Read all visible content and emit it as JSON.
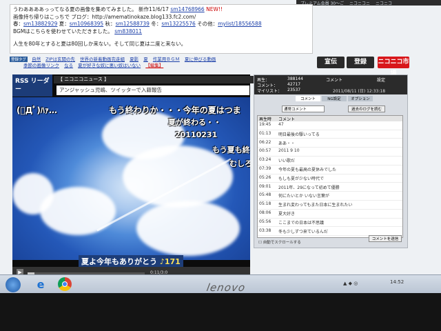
{
  "top_strip": [
    "プレミアム会員 30～ご",
    "ニコニコニ",
    "ニコニコ"
  ],
  "description": {
    "line1_text": "うわああああっってなる夏の画像を集めてみました。 新作11/6/17",
    "line1_link": "sm14768966",
    "line1_new": "NEW!!",
    "line2": "画像持ち帰りはこっちで ブログ：http://amematinokaze.blog133.fc2.com/",
    "line3_parts": [
      "春：",
      "sm13882929",
      " 夏：",
      "sm10968395",
      " 秋：",
      "sm12588739",
      " 冬：",
      "sm13225576",
      " その他：",
      "mylist/18556588"
    ],
    "line4_text": "BGMはこちらを使わせていただきました。",
    "line4_link": "sm838011",
    "line5": "人生を80年とすると夏は80回しか来ない。そして同じ夏は二度と来ない。"
  },
  "tags": {
    "lock_label": "登録タグ",
    "row1": [
      "自然",
      "ZIPは玄関の先",
      "世界の新着動画完走組",
      "夏影",
      "夏",
      "作業用ＢＧＭ",
      "夏に伸びる動画"
    ],
    "row2": [
      "季節の画像リンク",
      "なる",
      "夏が好きな奴に悪い奴はいない",
      "【編集】"
    ]
  },
  "buttons": {
    "ad": "宣伝",
    "mylist": "登録",
    "ichiba": "ニコニコ市場"
  },
  "player": {
    "rss": "RSS リーダー",
    "head": "【 ニコニコニュース 】",
    "news": "アンジャッシュ児嶋、ツイッターで入籍報告",
    "comments": [
      "(ﾟДﾟ)ﾊｧ…",
      "もう終わりか・・・今年の夏はつま",
      "夏が終わる・・",
      "20110231",
      "もう夏も終",
      "むしろ"
    ],
    "bottom_comment": "夏よ今年もありがとう",
    "bottom_num": "♪171",
    "play_icon": "play-icon",
    "time": "0:11/3:0",
    "progress": 0.06
  },
  "panel": {
    "stats": {
      "play_label": "再生：",
      "play_value": "388144",
      "comment_label": "コメント：",
      "comment_value": "42717",
      "mylist_label": "マイリスト：",
      "mylist_value": "23537"
    },
    "header_comment": "コメント",
    "header_settings": "設定",
    "date": "2011/08/11 (日) 12:33:18",
    "tabs": [
      "コメント",
      "NG設定",
      "オプション"
    ],
    "select": "通常コメント",
    "update_button": "過去のログを読む",
    "list_header": {
      "time": "再生時",
      "comment": "コメント"
    },
    "rows": [
      {
        "time": "19:45",
        "text": "47"
      },
      {
        "time": "01:13",
        "text": "明日最後の駆いってる"
      },
      {
        "time": "06:22",
        "text": "ああ・・"
      },
      {
        "time": "00:57",
        "text": "2011 9 10"
      },
      {
        "time": "03:24",
        "text": "いい歌だ"
      },
      {
        "time": "07:39",
        "text": "今年の夏も最高の夏休みでした"
      },
      {
        "time": "05:26",
        "text": "もしも夏が少ない時代で"
      },
      {
        "time": "09:01",
        "text": "2011年、29になって初めて優勝"
      },
      {
        "time": "05:48",
        "text": "何にたいとか いない言葉が"
      },
      {
        "time": "05:18",
        "text": "生まれ変わってもまた日本に生まれたい"
      },
      {
        "time": "08:06",
        "text": "夏大好き"
      },
      {
        "time": "05:56",
        "text": "ここまでの日本は不思議"
      },
      {
        "time": "03:38",
        "text": "冬も少しずつ来ているんだ"
      }
    ],
    "autoscroll": "自動でスクロールする",
    "send_button": "コメントを送信"
  },
  "taskbar": {
    "ctrl": "▲ ◆ ◎",
    "time": "14:52"
  },
  "brand": "lenovo"
}
